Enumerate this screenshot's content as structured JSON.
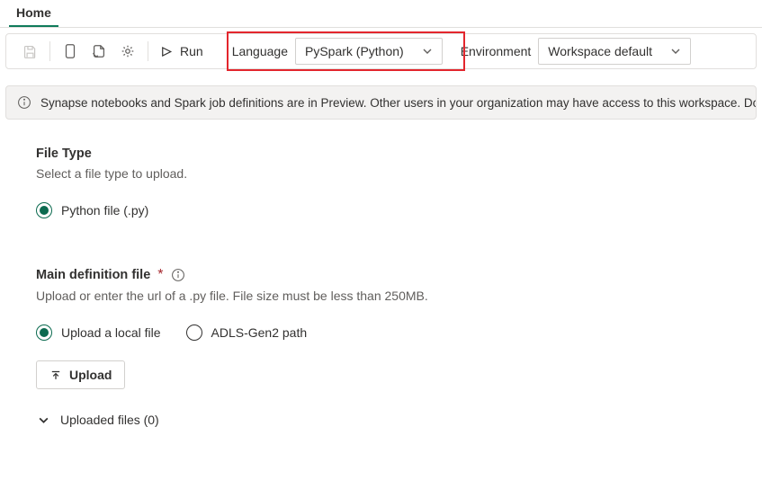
{
  "tabs": {
    "home": "Home"
  },
  "toolbar": {
    "run_label": "Run",
    "language_label": "Language",
    "language_value": "PySpark (Python)",
    "environment_label": "Environment",
    "environment_value": "Workspace default"
  },
  "banner": {
    "text": "Synapse notebooks and Spark job definitions are in Preview. Other users in your organization may have access to this workspace. Do not use these items"
  },
  "file_type": {
    "title": "File Type",
    "desc": "Select a file type to upload.",
    "option_python": "Python file (.py)"
  },
  "main_def": {
    "title": "Main definition file",
    "required_mark": "*",
    "desc": "Upload or enter the url of a .py file. File size must be less than 250MB.",
    "option_upload": "Upload a local file",
    "option_adls": "ADLS-Gen2 path",
    "upload_button": "Upload",
    "uploaded_files_label": "Uploaded files (0)"
  },
  "icons": {
    "save": "save-icon",
    "notebook": "notebook-icon",
    "import": "import-icon",
    "settings": "settings-icon",
    "play": "play-icon",
    "chevron_down": "chevron-down-icon",
    "info": "info-icon",
    "upload": "upload-icon"
  }
}
